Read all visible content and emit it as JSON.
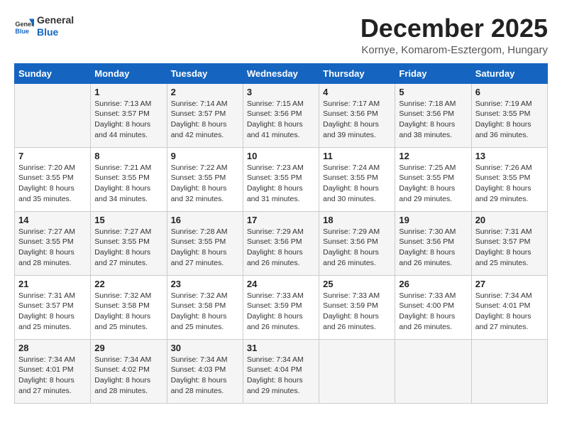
{
  "header": {
    "logo_line1": "General",
    "logo_line2": "Blue",
    "month": "December 2025",
    "location": "Kornye, Komarom-Esztergom, Hungary"
  },
  "days_of_week": [
    "Sunday",
    "Monday",
    "Tuesday",
    "Wednesday",
    "Thursday",
    "Friday",
    "Saturday"
  ],
  "weeks": [
    [
      {
        "day": "",
        "info": ""
      },
      {
        "day": "1",
        "info": "Sunrise: 7:13 AM\nSunset: 3:57 PM\nDaylight: 8 hours\nand 44 minutes."
      },
      {
        "day": "2",
        "info": "Sunrise: 7:14 AM\nSunset: 3:57 PM\nDaylight: 8 hours\nand 42 minutes."
      },
      {
        "day": "3",
        "info": "Sunrise: 7:15 AM\nSunset: 3:56 PM\nDaylight: 8 hours\nand 41 minutes."
      },
      {
        "day": "4",
        "info": "Sunrise: 7:17 AM\nSunset: 3:56 PM\nDaylight: 8 hours\nand 39 minutes."
      },
      {
        "day": "5",
        "info": "Sunrise: 7:18 AM\nSunset: 3:56 PM\nDaylight: 8 hours\nand 38 minutes."
      },
      {
        "day": "6",
        "info": "Sunrise: 7:19 AM\nSunset: 3:55 PM\nDaylight: 8 hours\nand 36 minutes."
      }
    ],
    [
      {
        "day": "7",
        "info": "Sunrise: 7:20 AM\nSunset: 3:55 PM\nDaylight: 8 hours\nand 35 minutes."
      },
      {
        "day": "8",
        "info": "Sunrise: 7:21 AM\nSunset: 3:55 PM\nDaylight: 8 hours\nand 34 minutes."
      },
      {
        "day": "9",
        "info": "Sunrise: 7:22 AM\nSunset: 3:55 PM\nDaylight: 8 hours\nand 32 minutes."
      },
      {
        "day": "10",
        "info": "Sunrise: 7:23 AM\nSunset: 3:55 PM\nDaylight: 8 hours\nand 31 minutes."
      },
      {
        "day": "11",
        "info": "Sunrise: 7:24 AM\nSunset: 3:55 PM\nDaylight: 8 hours\nand 30 minutes."
      },
      {
        "day": "12",
        "info": "Sunrise: 7:25 AM\nSunset: 3:55 PM\nDaylight: 8 hours\nand 29 minutes."
      },
      {
        "day": "13",
        "info": "Sunrise: 7:26 AM\nSunset: 3:55 PM\nDaylight: 8 hours\nand 29 minutes."
      }
    ],
    [
      {
        "day": "14",
        "info": "Sunrise: 7:27 AM\nSunset: 3:55 PM\nDaylight: 8 hours\nand 28 minutes."
      },
      {
        "day": "15",
        "info": "Sunrise: 7:27 AM\nSunset: 3:55 PM\nDaylight: 8 hours\nand 27 minutes."
      },
      {
        "day": "16",
        "info": "Sunrise: 7:28 AM\nSunset: 3:55 PM\nDaylight: 8 hours\nand 27 minutes."
      },
      {
        "day": "17",
        "info": "Sunrise: 7:29 AM\nSunset: 3:56 PM\nDaylight: 8 hours\nand 26 minutes."
      },
      {
        "day": "18",
        "info": "Sunrise: 7:29 AM\nSunset: 3:56 PM\nDaylight: 8 hours\nand 26 minutes."
      },
      {
        "day": "19",
        "info": "Sunrise: 7:30 AM\nSunset: 3:56 PM\nDaylight: 8 hours\nand 26 minutes."
      },
      {
        "day": "20",
        "info": "Sunrise: 7:31 AM\nSunset: 3:57 PM\nDaylight: 8 hours\nand 25 minutes."
      }
    ],
    [
      {
        "day": "21",
        "info": "Sunrise: 7:31 AM\nSunset: 3:57 PM\nDaylight: 8 hours\nand 25 minutes."
      },
      {
        "day": "22",
        "info": "Sunrise: 7:32 AM\nSunset: 3:58 PM\nDaylight: 8 hours\nand 25 minutes."
      },
      {
        "day": "23",
        "info": "Sunrise: 7:32 AM\nSunset: 3:58 PM\nDaylight: 8 hours\nand 25 minutes."
      },
      {
        "day": "24",
        "info": "Sunrise: 7:33 AM\nSunset: 3:59 PM\nDaylight: 8 hours\nand 26 minutes."
      },
      {
        "day": "25",
        "info": "Sunrise: 7:33 AM\nSunset: 3:59 PM\nDaylight: 8 hours\nand 26 minutes."
      },
      {
        "day": "26",
        "info": "Sunrise: 7:33 AM\nSunset: 4:00 PM\nDaylight: 8 hours\nand 26 minutes."
      },
      {
        "day": "27",
        "info": "Sunrise: 7:34 AM\nSunset: 4:01 PM\nDaylight: 8 hours\nand 27 minutes."
      }
    ],
    [
      {
        "day": "28",
        "info": "Sunrise: 7:34 AM\nSunset: 4:01 PM\nDaylight: 8 hours\nand 27 minutes."
      },
      {
        "day": "29",
        "info": "Sunrise: 7:34 AM\nSunset: 4:02 PM\nDaylight: 8 hours\nand 28 minutes."
      },
      {
        "day": "30",
        "info": "Sunrise: 7:34 AM\nSunset: 4:03 PM\nDaylight: 8 hours\nand 28 minutes."
      },
      {
        "day": "31",
        "info": "Sunrise: 7:34 AM\nSunset: 4:04 PM\nDaylight: 8 hours\nand 29 minutes."
      },
      {
        "day": "",
        "info": ""
      },
      {
        "day": "",
        "info": ""
      },
      {
        "day": "",
        "info": ""
      }
    ]
  ]
}
